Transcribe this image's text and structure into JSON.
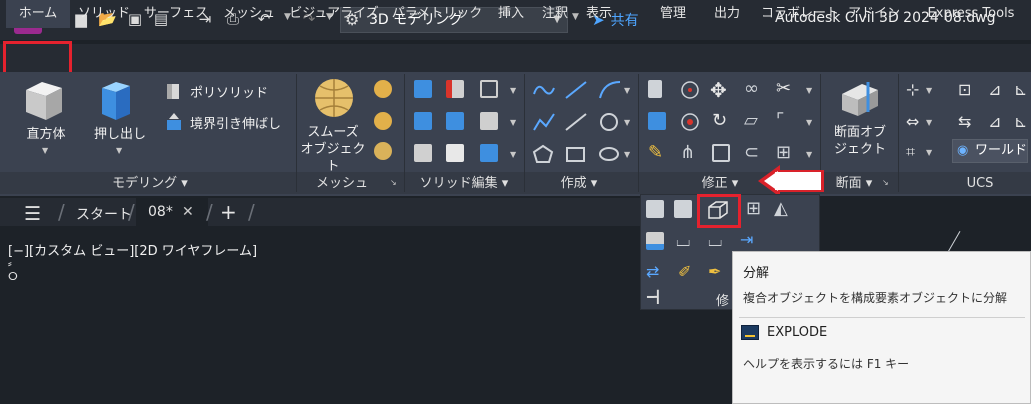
{
  "titlebar": {
    "app_icon_letter": "C",
    "workspace": "3D モデリング",
    "share": "共有",
    "app_title": "Autodesk Civil 3D 2024",
    "file_title": "08.dwg"
  },
  "tabs": [
    "ホーム",
    "ソリッド",
    "サーフェス",
    "メッシュ",
    "ビジュアライズ",
    "パラメトリック",
    "挿入",
    "注釈",
    "表示",
    "管理",
    "出力",
    "コラボレート",
    "アドイン",
    "Express Tools"
  ],
  "ribbon": {
    "modeling": {
      "box": "直方体",
      "extrude": "押し出し",
      "polysolid": "ポリソリッド",
      "presspull": "境界引き伸ばし",
      "title": "モデリング"
    },
    "mesh": {
      "smooth_line1": "スムーズ",
      "smooth_line2": "オブジェクト",
      "title": "メッシュ"
    },
    "solid_edit": {
      "title": "ソリッド編集"
    },
    "draw": {
      "title": "作成"
    },
    "modify": {
      "title": "修正"
    },
    "section": {
      "section_line1": "断面オブ",
      "section_line2": "ジェクト",
      "title": "断面"
    },
    "ucs": {
      "world": "ワールド",
      "title": "UCS"
    }
  },
  "filetabs": {
    "start": "スタート",
    "current": "08*"
  },
  "viewport": {
    "label": "[−][カスタム ビュー][2D ワイヤフレーム]"
  },
  "dropdown": {
    "title": "修"
  },
  "tooltip": {
    "title": "分解",
    "description": "複合オブジェクトを構成要素オブジェクトに分解",
    "command": "EXPLODE",
    "help": "ヘルプを表示するには F1 キー"
  },
  "colors": {
    "highlight": "#e5222e",
    "accent": "#4ea5ff",
    "app_icon": "#9b2a8f"
  }
}
